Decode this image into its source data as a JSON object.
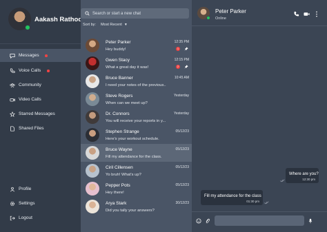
{
  "profile": {
    "name": "Aakash Rathod"
  },
  "sidebar": {
    "items": [
      {
        "label": "Messages",
        "icon": "messages-icon",
        "active": true,
        "dot": true
      },
      {
        "label": "Voice Calls",
        "icon": "phone-icon",
        "active": false,
        "dot": true
      },
      {
        "label": "Community",
        "icon": "community-icon",
        "active": false,
        "dot": false
      },
      {
        "label": "Video Calls",
        "icon": "video-icon",
        "active": false,
        "dot": false
      },
      {
        "label": "Starred Messages",
        "icon": "star-icon",
        "active": false,
        "dot": false
      },
      {
        "label": "Shared Files",
        "icon": "file-icon",
        "active": false,
        "dot": false
      }
    ],
    "bottom": [
      {
        "label": "Profile",
        "icon": "user-icon"
      },
      {
        "label": "Settings",
        "icon": "gear-icon"
      },
      {
        "label": "Logout",
        "icon": "logout-icon"
      }
    ]
  },
  "search": {
    "placeholder": "Search or start a new chat"
  },
  "sort": {
    "label": "Sort by:",
    "value": "Most Recent"
  },
  "chats": [
    {
      "name": "Peter Parker",
      "message": "Hey buddy!",
      "time": "12:35 PM",
      "badge": "1",
      "pinned": true
    },
    {
      "name": "Gwen Stacy",
      "message": "What a great day it was!",
      "time": "12:15 PM",
      "badge": "2",
      "pinned": true
    },
    {
      "name": "Bruce Banner",
      "message": "I need your notes of the previous...",
      "time": "10:45 AM",
      "badge": "",
      "pinned": false
    },
    {
      "name": "Steve Rogers",
      "message": "When can we meet up?",
      "time": "Yesterday",
      "badge": "",
      "pinned": false
    },
    {
      "name": "Dr. Connors",
      "message": "You will receive your reports in y...",
      "time": "Yesterday",
      "badge": "",
      "pinned": false
    },
    {
      "name": "Stephen Strange",
      "message": "Here's your workout schedule.",
      "time": "05/12/23",
      "badge": "",
      "pinned": false
    },
    {
      "name": "Bruce Wayne",
      "message": "Fill my attendance for the class.",
      "time": "05/12/23",
      "badge": "",
      "pinned": false,
      "selected": true
    },
    {
      "name": "Ciril Cillensen",
      "message": "Yo bruh! What's up?",
      "time": "05/12/23",
      "badge": "",
      "pinned": false
    },
    {
      "name": "Pepper Pots",
      "message": "Hey there!",
      "time": "05/12/23",
      "badge": "",
      "pinned": false
    },
    {
      "name": "Arya Stark",
      "message": "Did you tally your answers?",
      "time": "30/12/23",
      "badge": "",
      "pinned": false
    }
  ],
  "conversation": {
    "name": "Peter Parker",
    "status": "Online",
    "messages": [
      {
        "text": "Where are you?",
        "time": "12:30 pm",
        "outgoing": true
      },
      {
        "text": "Fill my attendance for the class",
        "time": "01:30 pm",
        "outgoing": false
      }
    ]
  },
  "colors": {
    "online": "#22c55e",
    "badge": "#ef4444",
    "sidebar": "#323b48",
    "list": "#4a5566",
    "conversation": "#3b4554"
  }
}
